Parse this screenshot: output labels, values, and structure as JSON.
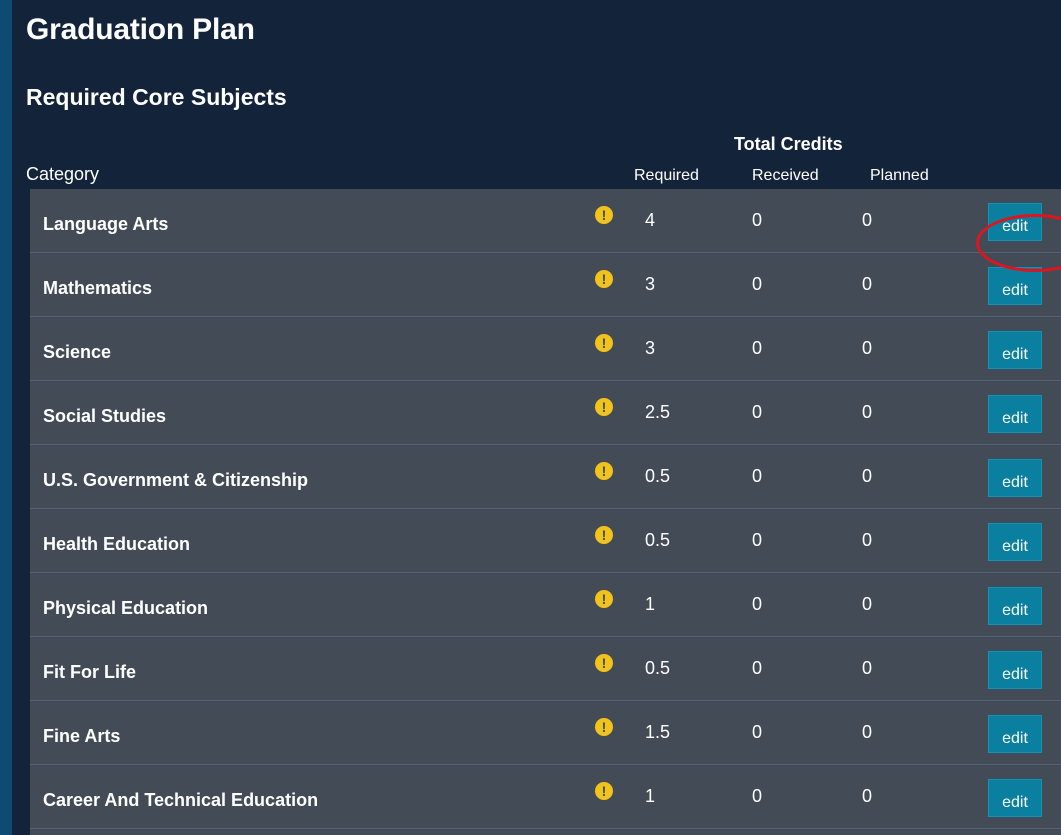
{
  "page": {
    "title": "Graduation Plan",
    "section_title": "Required Core Subjects"
  },
  "table": {
    "group_header": "Total Credits",
    "columns": {
      "category": "Category",
      "required": "Required",
      "received": "Received",
      "planned": "Planned"
    },
    "edit_label": "edit",
    "rows": [
      {
        "category": "Language Arts",
        "required": "4",
        "received": "0",
        "planned": "0",
        "edit": "edit"
      },
      {
        "category": "Mathematics",
        "required": "3",
        "received": "0",
        "planned": "0",
        "edit": "edit"
      },
      {
        "category": "Science",
        "required": "3",
        "received": "0",
        "planned": "0",
        "edit": "edit"
      },
      {
        "category": "Social Studies",
        "required": "2.5",
        "received": "0",
        "planned": "0",
        "edit": "edit"
      },
      {
        "category": "U.S. Government & Citizenship",
        "required": "0.5",
        "received": "0",
        "planned": "0",
        "edit": "edit"
      },
      {
        "category": "Health Education",
        "required": "0.5",
        "received": "0",
        "planned": "0",
        "edit": "edit"
      },
      {
        "category": "Physical Education",
        "required": "1",
        "received": "0",
        "planned": "0",
        "edit": "edit"
      },
      {
        "category": "Fit For Life",
        "required": "0.5",
        "received": "0",
        "planned": "0",
        "edit": "edit"
      },
      {
        "category": "Fine Arts",
        "required": "1.5",
        "received": "0",
        "planned": "0",
        "edit": "edit"
      },
      {
        "category": "Career And Technical Education",
        "required": "1",
        "received": "0",
        "planned": "0",
        "edit": "edit"
      }
    ]
  },
  "icons": {
    "warning": "warning-icon",
    "warning_glyph": "!"
  },
  "colors": {
    "background": "#12233a",
    "outer_border": "#0e4a72",
    "table_rows": "#434b57",
    "edit_button": "#0a7fa0",
    "warning": "#f2c31b",
    "annotation": "#e0141f"
  }
}
